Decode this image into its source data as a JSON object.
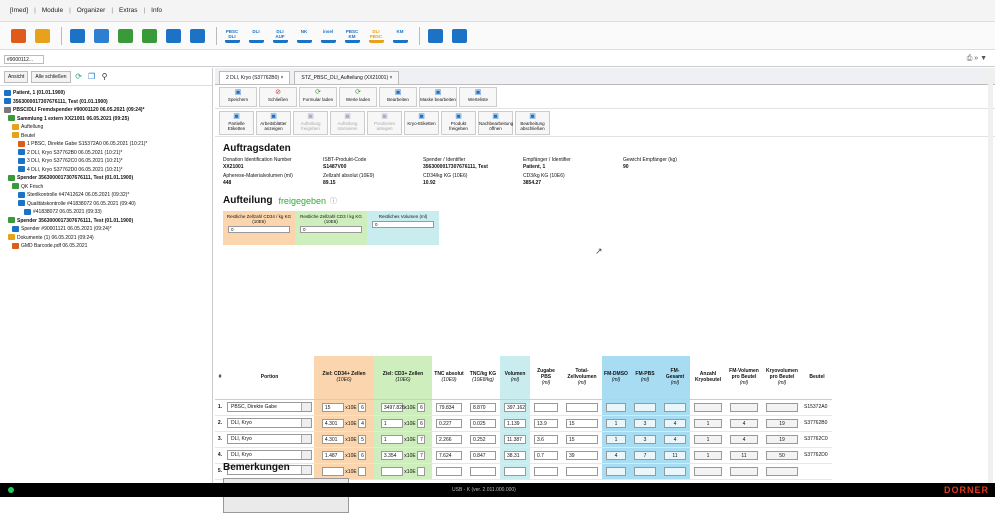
{
  "menu": {
    "items": [
      "[Imed]",
      "Module",
      "Organizer",
      "Extras",
      "Info"
    ]
  },
  "toolbar": {
    "buttons": [
      {
        "name": "patient-icon",
        "color": "#e05a1a"
      },
      {
        "name": "case-icon",
        "color": "#e7a21a"
      },
      {
        "name": "search-icon",
        "color": "#1c73c6"
      },
      {
        "name": "report-icon",
        "color": "#2d7fd0"
      },
      {
        "name": "print-icon",
        "color": "#3a9a3a"
      },
      {
        "name": "export-icon",
        "color": "#3a9a3a"
      },
      {
        "name": "lab-icon",
        "color": "#1c73c6"
      },
      {
        "name": "stats-icon",
        "color": "#1c73c6"
      },
      {
        "name": "pbsc-dli-icon",
        "color": "#1c73c6",
        "label": "PBSC DLI"
      },
      {
        "name": "dli-icon",
        "color": "#1c73c6",
        "label": "DLI"
      },
      {
        "name": "dli-auf-icon",
        "color": "#1c73c6",
        "label": "DLI AUF"
      },
      {
        "name": "nk-icon",
        "color": "#1c73c6",
        "label": "NK"
      },
      {
        "name": "insel-icon",
        "color": "#1c73c6",
        "label": "insel"
      },
      {
        "name": "pbsc-km-icon",
        "color": "#1c73c6",
        "label": "PBSC KM"
      },
      {
        "name": "dli-pbsc-icon",
        "color": "#e7a21a",
        "label": "DLI PBSC"
      },
      {
        "name": "km-icon",
        "color": "#1c73c6",
        "label": "KM"
      },
      {
        "name": "clock-icon",
        "color": "#1c73c6"
      },
      {
        "name": "calendar-icon",
        "color": "#1c73c6"
      }
    ]
  },
  "address": {
    "field": "#9000112...",
    "right_icons": "⎙ » ▼"
  },
  "left": {
    "buttons": [
      "Ansicht",
      "Alle schließen"
    ],
    "tree": [
      "Patient, 1 (01.01.1900)",
      "3563000017307676111, Test (01.01.1900)",
      "PBSC/DLI Fremdspender #90001120 06.05.2021 (09:24)*",
      "Sammlung 1 extern XX21001 06.05.2021 (09:25)",
      "Auftellung",
      "Beutel",
      "1 PBSC, Direkte Gabe S15372A0 06.05.2021 (10:21)*",
      "2 DLI, Kryo S37762B0 06.05.2021 (10:21)*",
      "3 DLI, Kryo S37762C0 06.05.2021 (10:21)*",
      "4 DLI, Kryo S37762D0 06.05.2021 (10:21)*",
      "Spender 3563000017307676111, Test (01.01.1900)",
      "QK Frisch",
      "Sterilkontrolle #47412624 06.05.2021 (09:32)*",
      "Qualitätskontrolle #41838072 06.05.2021 (09:40)",
      "#41838072 06.05.2021 (09:33)",
      "Spender 3563000017307676111, Test (01.01.1900)",
      "Spender #90001121 06.05.2021 (09:24)*",
      "Dokumente (1) 06.05.2021 (09:24)",
      "GMD Barcode.pdf 06.05.2021"
    ]
  },
  "tabs": [
    "2 DLI, Kryo (S37762B0)",
    "STZ_PBSC_DLI_Aufteilung (XX21001)"
  ],
  "ribbon1": [
    {
      "icon": "save-icon",
      "label": "Speichern",
      "enabled": true
    },
    {
      "icon": "close-icon",
      "label": "Schließen",
      "enabled": true
    },
    {
      "icon": "reload-form-icon",
      "label": "Formular laden",
      "enabled": true
    },
    {
      "icon": "reload-values-icon",
      "label": "Werte laden",
      "enabled": true
    },
    {
      "icon": "edit-icon",
      "label": "Bearbeiten",
      "enabled": true
    },
    {
      "icon": "mask-edit-icon",
      "label": "Maske bearbeiten",
      "enabled": true
    },
    {
      "icon": "value-list-icon",
      "label": "Werteliste",
      "enabled": true
    }
  ],
  "ribbon2": [
    {
      "icon": "label-icon",
      "label": "Partielle Etiketten",
      "enabled": true
    },
    {
      "icon": "worksheet-icon",
      "label": "Arbeitsblätter anzeigen",
      "enabled": true
    },
    {
      "icon": "release-icon",
      "label": "Aufteilung freigeben",
      "enabled": false
    },
    {
      "icon": "cancel-release-icon",
      "label": "Aufteilung stornieren",
      "enabled": false
    },
    {
      "icon": "create-pos-icon",
      "label": "Positionen anlegen",
      "enabled": false
    },
    {
      "icon": "cryo-label-icon",
      "label": "Kryo-Etiketten",
      "enabled": true
    },
    {
      "icon": "product-release-icon",
      "label": "Produkt freigeben",
      "enabled": true
    },
    {
      "icon": "edit-open-icon",
      "label": "Nachbearbeitung öffnen",
      "enabled": true
    },
    {
      "icon": "finish-icon",
      "label": "Bearbeitung abschließen",
      "enabled": true
    }
  ],
  "section_title": "Auftragsdaten",
  "info": [
    {
      "label": "Donation Identification Number",
      "value": "XX21001"
    },
    {
      "label": "ISBT-Produkt-Code",
      "value": "S1487V00"
    },
    {
      "label": "Spender / Identifier",
      "value": "3563000017307676111, Test"
    },
    {
      "label": "Empfänger / Identifier",
      "value": "Patient, 1"
    },
    {
      "label": "Gewicht Empfänger (kg)",
      "value": "90"
    }
  ],
  "info2": [
    {
      "label": "Apherese-Materialvolumen (ml)",
      "value": "448"
    },
    {
      "label": "Zellzahl absolut (10E9)",
      "value": "89.15"
    },
    {
      "label": "CD34/kg KG (10E6)",
      "value": "10.92"
    },
    {
      "label": "CD3/kg KG (10E6)",
      "value": "3854.27"
    }
  ],
  "auf": {
    "title": "Aufteilung",
    "status": "freigegeben",
    "icon": "info-icon"
  },
  "rest": [
    {
      "label": "Restliche Zellzahl CD34 / kg KG (10E6)",
      "value": "0",
      "color": "#fbd5ad"
    },
    {
      "label": "Restliche Zellzahl CD3 / kg KG (10E6)",
      "value": "0",
      "color": "#cfeebe"
    },
    {
      "label": "Restliches Volumen (ml)",
      "value": "0",
      "color": "#c9ecee"
    }
  ],
  "table": {
    "headers": [
      {
        "t": "#",
        "s": ""
      },
      {
        "t": "Portion",
        "s": ""
      },
      {
        "t": "Ziel: CD34+ Zellen",
        "s": "(10E6)"
      },
      {
        "t": "Ziel: CD3+ Zellen",
        "s": "(10E6)"
      },
      {
        "t": "TNC absolut",
        "s": "(10E9)"
      },
      {
        "t": "TNC/kg KG",
        "s": "(10E8/kg)"
      },
      {
        "t": "Volumen",
        "s": "(ml)"
      },
      {
        "t": "Zugabe PBS",
        "s": "(ml)"
      },
      {
        "t": "Total-Zellvolumen",
        "s": "(ml)"
      },
      {
        "t": "FM-DMSO",
        "s": "(ml)"
      },
      {
        "t": "FM-PBS",
        "s": "(ml)"
      },
      {
        "t": "FM-Gesamt",
        "s": "(ml)"
      },
      {
        "t": "Anzahl Kryobeutel",
        "s": ""
      },
      {
        "t": "FM-Volumen pro Beutel",
        "s": "(ml)"
      },
      {
        "t": "Kryovolumen pro Beutel",
        "s": "(ml)"
      },
      {
        "t": "Beutel",
        "s": ""
      }
    ],
    "rows": [
      {
        "n": "1.",
        "portion": "PBSC, Direkte Gabe",
        "cd34": "15",
        "cd34e": "6",
        "cd3": "3497.826",
        "cd3e": "6",
        "tnc": "79.834",
        "tnckg": "8.870",
        "vol": "397.162",
        "pbs": "",
        "total": "",
        "dmso": "",
        "fmpbs": "",
        "fmges": "",
        "anz": "",
        "fmvol": "",
        "kryo": "",
        "beutel": "S15372A0"
      },
      {
        "n": "2.",
        "portion": "DLI, Kryo",
        "cd34": "4.301",
        "cd34e": "4",
        "cd3": "1",
        "cd3e": "6",
        "tnc": "0.227",
        "tnckg": "0.025",
        "vol": "1.139",
        "pbs": "13.9",
        "total": "15",
        "dmso": "1",
        "fmpbs": "3",
        "fmges": "4",
        "anz": "1",
        "fmvol": "4",
        "kryo": "19",
        "beutel": "S37762B0"
      },
      {
        "n": "3.",
        "portion": "DLI, Kryo",
        "cd34": "4.301",
        "cd34e": "5",
        "cd3": "1",
        "cd3e": "7",
        "tnc": "2.266",
        "tnckg": "0.252",
        "vol": "11.387",
        "pbs": "3.6",
        "total": "15",
        "dmso": "1",
        "fmpbs": "3",
        "fmges": "4",
        "anz": "1",
        "fmvol": "4",
        "kryo": "19",
        "beutel": "S37762C0"
      },
      {
        "n": "4.",
        "portion": "DLI, Kryo",
        "cd34": "1.487",
        "cd34e": "6",
        "cd3": "3.354",
        "cd3e": "7",
        "tnc": "7.624",
        "tnckg": "0.847",
        "vol": "38.31",
        "pbs": "0.7",
        "total": "39",
        "dmso": "4",
        "fmpbs": "7",
        "fmges": "11",
        "anz": "1",
        "fmvol": "11",
        "kryo": "50",
        "beutel": "S37762D0"
      },
      {
        "n": "5.",
        "portion": "",
        "cd34": "",
        "cd34e": "",
        "cd3": "",
        "cd3e": "",
        "tnc": "",
        "tnckg": "",
        "vol": "",
        "pbs": "",
        "total": "",
        "dmso": "",
        "fmpbs": "",
        "fmges": "",
        "anz": "",
        "fmvol": "",
        "kryo": "",
        "beutel": ""
      }
    ]
  },
  "remarks_title": "Bemerkungen",
  "footer": {
    "status": "USB - K   (ver. 2.011.000.000)",
    "logo": "DORNER"
  }
}
